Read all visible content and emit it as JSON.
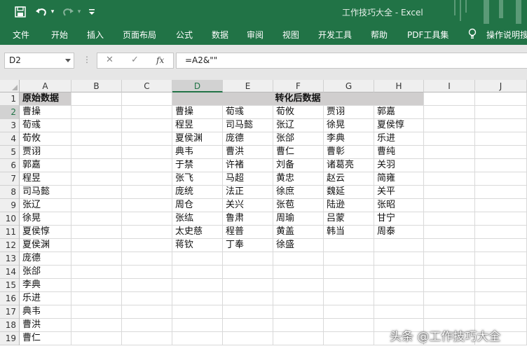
{
  "titlebar": {
    "title": "工作技巧大全  -  Excel",
    "accent": "#217346",
    "qat": [
      {
        "name": "save-icon",
        "glyph": "💾"
      },
      {
        "name": "undo-icon",
        "glyph": "↶"
      },
      {
        "name": "undo-dropdown-icon",
        "glyph": "▾"
      },
      {
        "name": "redo-icon",
        "glyph": "↷"
      },
      {
        "name": "redo-dropdown-icon",
        "glyph": "▾"
      },
      {
        "name": "customize-qat-icon",
        "glyph": "⩡"
      }
    ]
  },
  "ribbon": {
    "tabs": [
      "文件",
      "开始",
      "插入",
      "页面布局",
      "公式",
      "数据",
      "审阅",
      "视图",
      "开发工具",
      "帮助",
      "PDF工具集"
    ],
    "tell_me": "操作说明搜"
  },
  "formula_bar": {
    "name_box": "D2",
    "cancel_glyph": "✕",
    "enter_glyph": "✓",
    "fx_glyph": "fx",
    "formula": "=A2&\"\""
  },
  "grid": {
    "columns": [
      "A",
      "B",
      "C",
      "D",
      "E",
      "F",
      "G",
      "H",
      "I",
      "J"
    ],
    "rows": [
      "1",
      "2",
      "3",
      "4",
      "5",
      "6",
      "7",
      "8",
      "9",
      "10",
      "11",
      "12",
      "13",
      "14",
      "15",
      "16",
      "17",
      "18",
      "19"
    ],
    "header_a1": "原始数据",
    "header_d1": "转化后数据",
    "source_names": [
      "曹操",
      "荀彧",
      "荀攸",
      "贾诩",
      "郭嘉",
      "程昱",
      "司马懿",
      "张辽",
      "徐晃",
      "夏侯惇",
      "夏侯渊",
      "庞德",
      "张郃",
      "李典",
      "乐进",
      "典韦",
      "曹洪",
      "曹仁"
    ],
    "transformed": [
      [
        "曹操",
        "荀彧",
        "荀攸",
        "贾诩",
        "郭嘉"
      ],
      [
        "程昱",
        "司马懿",
        "张辽",
        "徐晃",
        "夏侯惇"
      ],
      [
        "夏侯渊",
        "庞德",
        "张郃",
        "李典",
        "乐进"
      ],
      [
        "典韦",
        "曹洪",
        "曹仁",
        "曹彰",
        "曹纯"
      ],
      [
        "于禁",
        "许褚",
        "刘备",
        "诸葛亮",
        "关羽"
      ],
      [
        "张飞",
        "马超",
        "黄忠",
        "赵云",
        "简雍"
      ],
      [
        "庞统",
        "法正",
        "徐庶",
        "魏延",
        "关平"
      ],
      [
        "周仓",
        "关兴",
        "张苞",
        "陆逊",
        "张昭"
      ],
      [
        "张纮",
        "鲁肃",
        "周瑜",
        "吕蒙",
        "甘宁"
      ],
      [
        "太史慈",
        "程普",
        "黄盖",
        "韩当",
        "周泰"
      ],
      [
        "蒋钦",
        "丁奉",
        "徐盛"
      ]
    ]
  },
  "watermark": "头条 @工作技巧大全"
}
